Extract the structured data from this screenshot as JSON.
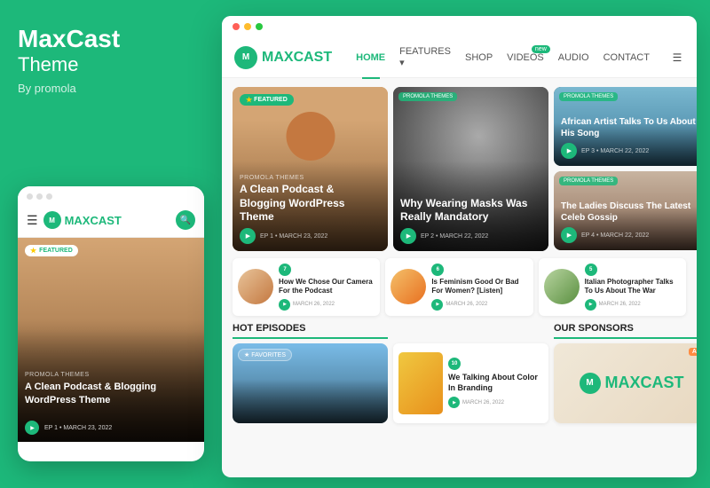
{
  "brand": {
    "name": "MaxCast",
    "subtitle": "Theme",
    "byline": "By promola",
    "logo_letter": "M"
  },
  "header": {
    "logo_text_part1": "MAX",
    "logo_text_part2": "CAST",
    "logo_letter": "M",
    "nav": {
      "home": "HOME",
      "features": "FEATURES",
      "shop": "SHOP",
      "videos": "VIDEOS",
      "audio": "AUDIO",
      "contact": "CONTACT",
      "videos_badge": "new"
    }
  },
  "featured_cards": {
    "card1": {
      "label": "PROMOLA THEMES",
      "title": "A Clean Podcast & Blogging WordPress Theme",
      "ep": "EP 1",
      "date": "MARCH 23, 2022",
      "badge": "FEATURED"
    },
    "card2": {
      "label": "PROMOLA THEMES",
      "title": "Why Wearing Masks Was Really Mandatory",
      "ep": "EP 2",
      "date": "MARCH 22, 2022"
    },
    "card3": {
      "label": "PROMOLA THEMES",
      "title": "African Artist Talks To Us About His Song",
      "ep": "EP 3",
      "date": "MARCH 22, 2022"
    },
    "card4": {
      "label": "PROMOLA THEMES",
      "title": "The Ladies Discuss The Latest Celeb Gossip",
      "ep": "EP 4",
      "date": "MARCH 22, 2022"
    }
  },
  "episodes": {
    "ep1": {
      "num": "7",
      "title": "How We Chose Our Camera For the Podcast",
      "date": "MARCH 26, 2022"
    },
    "ep2": {
      "num": "6",
      "title": "Is Feminism Good Or Bad For Women? [Listen]",
      "date": "MARCH 26, 2022"
    },
    "ep3": {
      "num": "5",
      "title": "Italian Photographer Talks To Us About The War",
      "date": "MARCH 26, 2022"
    }
  },
  "sections": {
    "hot_episodes": "HOT EPISODES",
    "our_sponsors": "OUR SPONSORS"
  },
  "bottom": {
    "favorites_badge": "★ FAVORITES",
    "ep_title": "We Talking About Color In Branding",
    "ep_num": "10",
    "ep_date": "MARCH 26, 2022",
    "ad_badge": "AD",
    "sponsor_letter": "M",
    "sponsor_name_part1": "MAX",
    "sponsor_name_part2": "CAST"
  },
  "mobile": {
    "featured_badge": "FEATURED",
    "card_label": "PROMOLA THEMES",
    "card_title": "A Clean Podcast & Blogging WordPress Theme",
    "card_ep": "EP 1 • MARCH 23, 2022"
  }
}
